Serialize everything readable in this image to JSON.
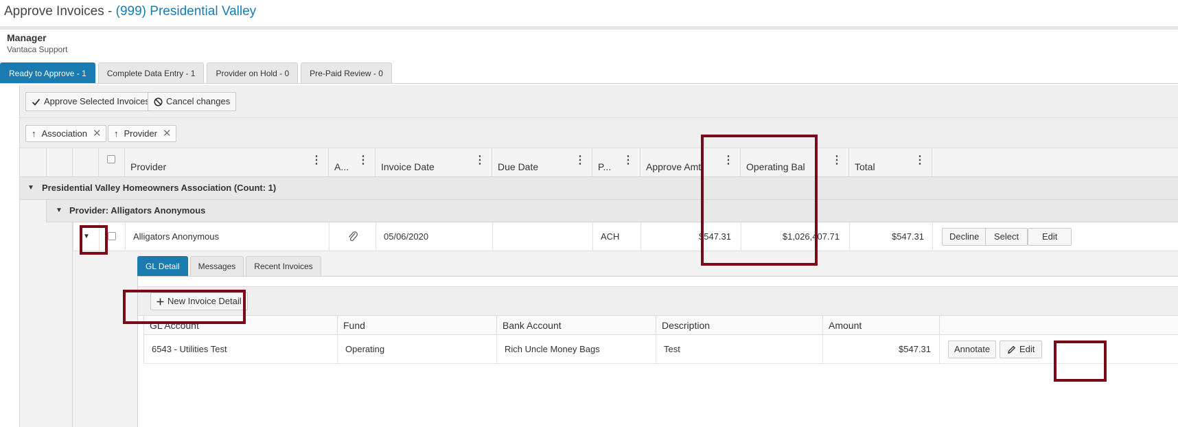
{
  "page": {
    "title_prefix": "Approve Invoices - ",
    "association": "(999) Presidential Valley",
    "role": "Manager",
    "user": "Vantaca Support"
  },
  "tabs": [
    {
      "label": "Ready to Approve - 1",
      "active": true
    },
    {
      "label": "Complete Data Entry - 1",
      "active": false
    },
    {
      "label": "Provider on Hold - 0",
      "active": false
    },
    {
      "label": "Pre-Paid Review - 0",
      "active": false
    }
  ],
  "toolbar": {
    "approve_label": "Approve Selected Invoices",
    "cancel_label": "Cancel changes"
  },
  "grouping": [
    {
      "label": "Association"
    },
    {
      "label": "Provider"
    }
  ],
  "columns": {
    "provider": "Provider",
    "attachment": "A...",
    "invoice_date": "Invoice Date",
    "due_date": "Due Date",
    "payment": "P...",
    "approve_amt": "Approve Amt",
    "operating_bal": "Operating Bal",
    "total": "Total"
  },
  "groups": {
    "association": "Presidential Valley Homeowners Association (Count: 1)",
    "provider": "Provider: Alligators Anonymous"
  },
  "invoice": {
    "provider": "Alligators Anonymous",
    "invoice_date": "05/06/2020",
    "due_date": "",
    "payment": "ACH",
    "approve_amt": "$547.31",
    "operating_bal": "$1,026,407.71",
    "total": "$547.31",
    "decline_label": "Decline",
    "select_label": "Select",
    "edit_label": "Edit"
  },
  "detail_tabs": [
    {
      "label": "GL Detail",
      "active": true
    },
    {
      "label": "Messages",
      "active": false
    },
    {
      "label": "Recent Invoices",
      "active": false
    }
  ],
  "detail": {
    "new_label": "New Invoice Detail",
    "columns": {
      "gl_account": "GL Account",
      "fund": "Fund",
      "bank_account": "Bank Account",
      "description": "Description",
      "amount": "Amount"
    },
    "row": {
      "gl_account": "6543 - Utilities Test",
      "fund": "Operating",
      "bank_account": "Rich Uncle Money Bags",
      "description": "Test",
      "amount": "$547.31",
      "annotate_label": "Annotate",
      "edit_label": "Edit"
    }
  },
  "colors": {
    "accent": "#1a7bb0",
    "highlight": "#7a0a1a"
  }
}
